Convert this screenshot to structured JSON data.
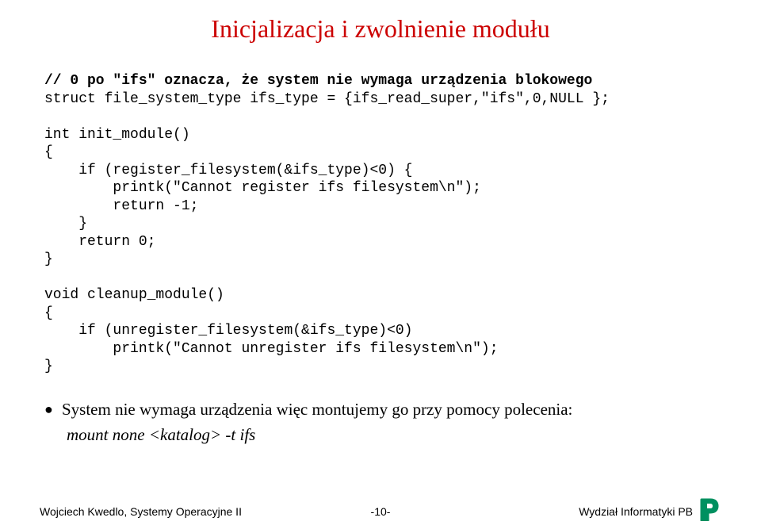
{
  "title": "Inicjalizacja i zwolnienie modułu",
  "code": {
    "comment": "// 0 po \"ifs\" oznacza, że system nie wymaga urządzenia blokowego",
    "line1": "struct file_system_type ifs_type = {ifs_read_super,\"ifs\",0,NULL };",
    "blank1": "",
    "line2": "int init_module()",
    "line3": "{",
    "line4": "    if (register_filesystem(&ifs_type)<0) {",
    "line5": "        printk(\"Cannot register ifs filesystem\\n\");",
    "line6": "        return -1;",
    "line7": "    }",
    "line8": "    return 0;",
    "line9": "}",
    "blank2": "",
    "line10": "void cleanup_module()",
    "line11": "{",
    "line12": "    if (unregister_filesystem(&ifs_type)<0)",
    "line13": "        printk(\"Cannot unregister ifs filesystem\\n\");",
    "line14": "}"
  },
  "bullet": {
    "text": "System nie wymaga urządzenia więc montujemy go przy pomocy polecenia:",
    "sub": "mount none <katalog> -t ifs"
  },
  "footer": {
    "left": "Wojciech Kwedlo, Systemy Operacyjne II",
    "center": "-10-",
    "right": "Wydział Informatyki      PB"
  }
}
